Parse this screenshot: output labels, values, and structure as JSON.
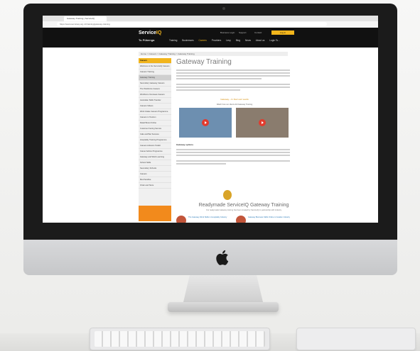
{
  "browser": {
    "tab_title": "Gateway Training | ServiceIQ",
    "url": "https://www.serviceiq.org.nz/training/gateway-training"
  },
  "site": {
    "logo_main": "Service",
    "logo_accent": "IQ",
    "logo_sub": "Tu Pūkenga",
    "top_button": "Log in",
    "header_links": [
      "Business Login",
      "Support",
      "Contact"
    ],
    "nav": [
      "Training",
      "Businesses",
      "Careers",
      "Providers",
      "Levy",
      "Blog",
      "News",
      "About us",
      "Login To..."
    ]
  },
  "breadcrumb": "Home > Careers > Gateway Training > Gateway Training",
  "sidebar": {
    "items": [
      "Careers",
      "Welcome to the ServiceIQ Careers",
      "Careers Training",
      "Gateway Training",
      "Secondary Gateway Careers",
      "The Workforce Careers",
      "Workforce Overseas Careers",
      "Australian Skills Transfer",
      "Careers Videos",
      "Work Intake Careers Programme",
      "Careers in Tourism",
      "Retail Boost Online",
      "Customer Facing Service",
      "Cafe and Bar Success",
      "Hospitality Training Programme",
      "Careers Advisors Toolkit",
      "Career Advice Programme",
      "Gateway and Work Learning",
      "School Skills",
      "Secondary Schools",
      "Careers",
      "Merchandise",
      "Order and Store"
    ]
  },
  "main": {
    "title": "Gateway Training",
    "cta": "Gateway – In their own words",
    "cta_sub": "Watch how our clients did Gateway Training",
    "section_heading": "Gateway options",
    "big_title": "Readymade ServiceIQ Gateway Training",
    "big_sub": "Our readymade Gateway training has been created by ServiceIQ in partnership with industry",
    "cards": [
      "The Gateway Work Skills in Hospitality Industry",
      "Gateway Business Skills Online in Aviation Industry"
    ]
  },
  "colors": {
    "accent": "#f2b51c",
    "header": "#111111"
  }
}
